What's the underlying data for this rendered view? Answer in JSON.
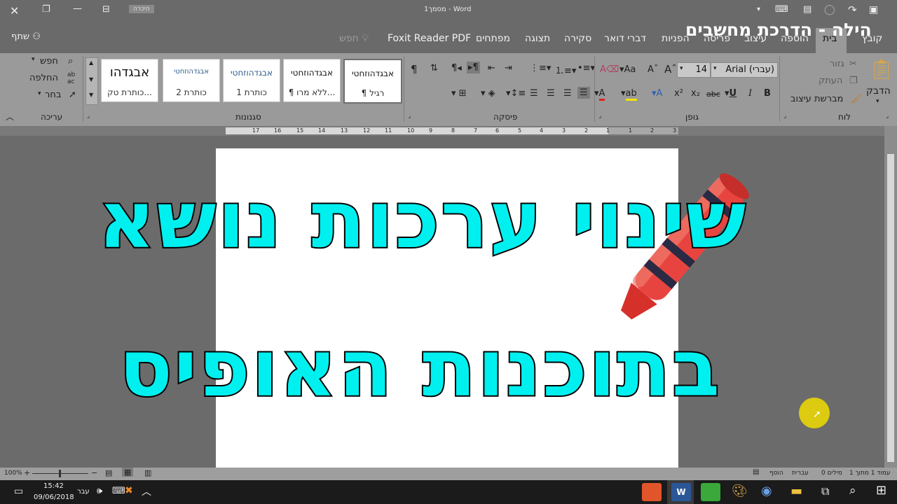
{
  "titlebar": {
    "title": "מסמך1 - Word",
    "mode_badge": "היכרה"
  },
  "overlay_title": "הילה - הדרכת מחשבים",
  "tabs": [
    {
      "label": "קובץ"
    },
    {
      "label": "בית"
    },
    {
      "label": "הוספה"
    },
    {
      "label": "עיצוב"
    },
    {
      "label": "פריסה"
    },
    {
      "label": "הפניות"
    },
    {
      "label": "דברי דואר"
    },
    {
      "label": "סקירה"
    },
    {
      "label": "תצוגה"
    },
    {
      "label": "מפתחים"
    },
    {
      "label": "Foxit Reader PDF"
    }
  ],
  "search_label": "חפש",
  "share_label": "שתף",
  "clipboard": {
    "paste": "הדבק",
    "cut": "גזור",
    "copy": "העתק",
    "format_painter": "מברשת עיצוב",
    "group": "לוח"
  },
  "font": {
    "name": "Arial (עברי)",
    "size": "14",
    "group": "גופן"
  },
  "paragraph": {
    "group": "פיסקה"
  },
  "styles": {
    "group": "סגנונות",
    "items": [
      {
        "sample": "אבגדהוזחטי",
        "name": "¶ רגיל"
      },
      {
        "sample": "אבגדהוזחטי",
        "name": "¶ ללא מרו..."
      },
      {
        "sample": "אבגדהוזחטי",
        "name": "כותרת 1"
      },
      {
        "sample": "אבגדהוזחטי",
        "name": "כותרת 2"
      },
      {
        "sample": "אבגדהו",
        "name": "כותרת טק..."
      }
    ]
  },
  "editing": {
    "find": "חפש",
    "replace": "החלפה",
    "select": "בחר",
    "group": "עריכה"
  },
  "document": {
    "line1": "שינוי ערכות נושא",
    "line2": "בתוכנות האופיס"
  },
  "ruler_numbers": [
    "3",
    "2",
    "1",
    "1",
    "2",
    "3",
    "4",
    "5",
    "6",
    "7",
    "8",
    "9",
    "10",
    "11",
    "12",
    "13",
    "14",
    "15",
    "16",
    "17"
  ],
  "statusbar": {
    "page": "עמוד 1 מתוך 1",
    "words": "0 מילים",
    "language": "עברית",
    "insert": "הוסף",
    "zoom": "100%"
  },
  "taskbar": {
    "time": "15:42",
    "date": "09/06/2018",
    "lang": "עבר"
  },
  "colors": {
    "accent_text": "#00f0f0",
    "ribbon_bg": "#9a9a9a",
    "title_bg": "#6a6a6a"
  }
}
